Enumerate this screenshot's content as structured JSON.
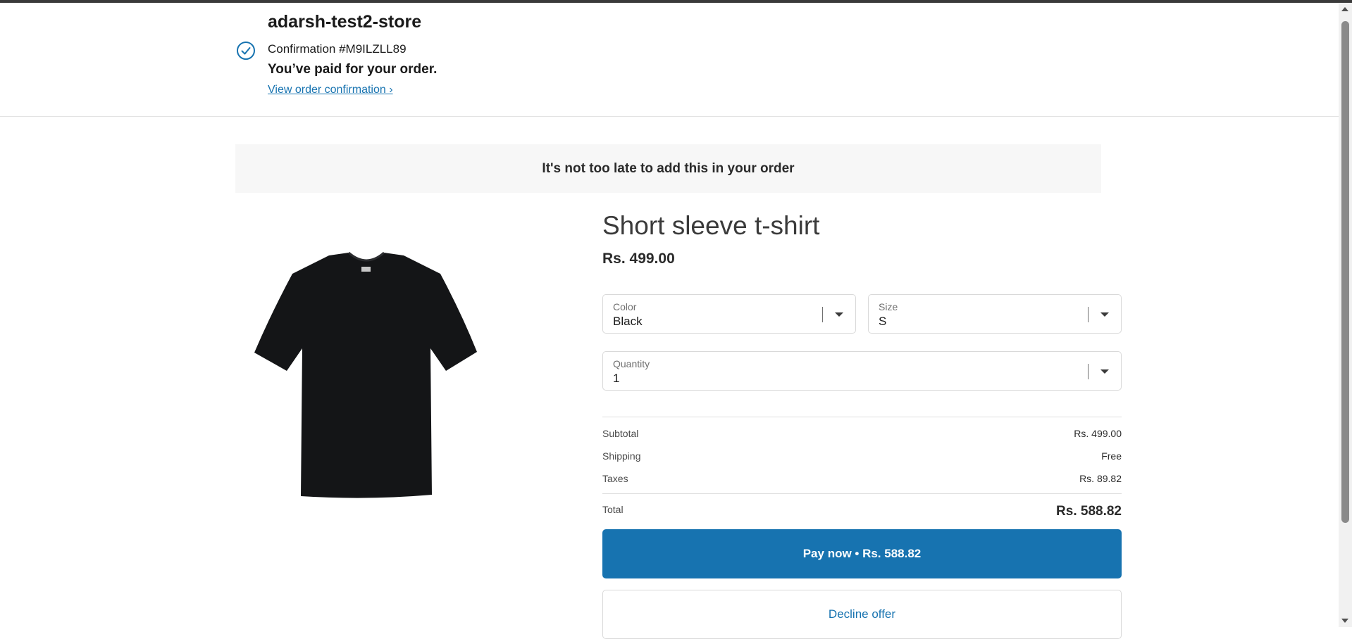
{
  "header": {
    "store_name": "adarsh-test2-store",
    "confirmation": "Confirmation #M9ILZLL89",
    "paid_message": "You’ve paid for your order.",
    "view_confirmation_link": "View order confirmation ›"
  },
  "banner": {
    "text": "It's not too late to add this in your order"
  },
  "product": {
    "title": "Short sleeve t-shirt",
    "price": "Rs. 499.00",
    "image_icon": "tshirt-image"
  },
  "options": {
    "color": {
      "label": "Color",
      "value": "Black"
    },
    "size": {
      "label": "Size",
      "value": "S"
    },
    "quantity": {
      "label": "Quantity",
      "value": "1"
    }
  },
  "summary": {
    "subtotal_label": "Subtotal",
    "subtotal_value": "Rs. 499.00",
    "shipping_label": "Shipping",
    "shipping_value": "Free",
    "taxes_label": "Taxes",
    "taxes_value": "Rs. 89.82",
    "total_label": "Total",
    "total_value": "Rs. 588.82"
  },
  "actions": {
    "pay_label": "Pay now • Rs. 588.82",
    "decline_label": "Decline offer"
  },
  "colors": {
    "accent": "#1773b0",
    "banner_bg": "#f7f7f7",
    "border": "#d9d9d9"
  }
}
